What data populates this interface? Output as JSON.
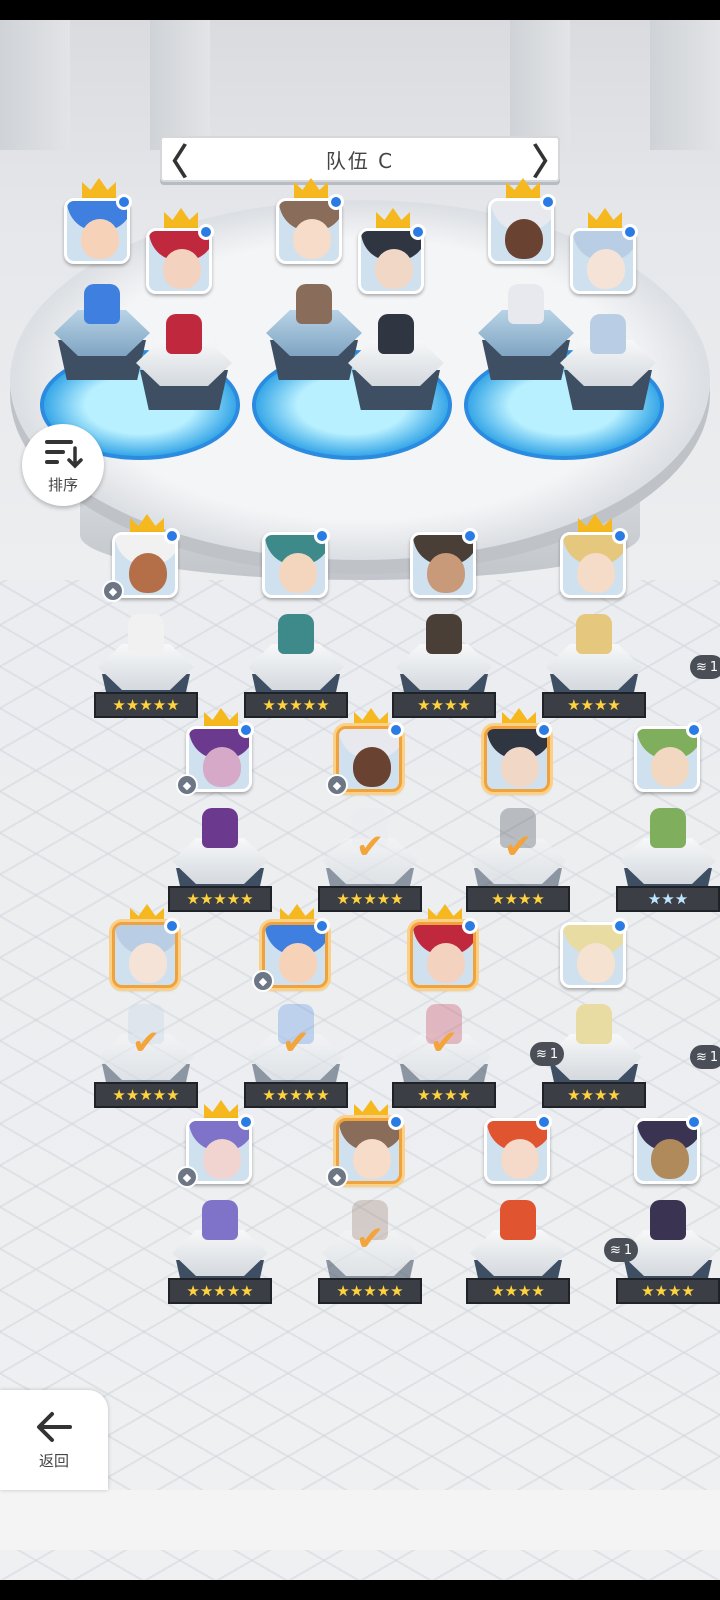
{
  "header": {
    "team_title": "队伍 C",
    "prev_label": "〈",
    "next_label": "〉"
  },
  "sort": {
    "label": "排序",
    "icon": "sort-icon"
  },
  "back": {
    "label": "返回",
    "icon": "arrow-left-icon"
  },
  "team_slots": [
    {
      "hair": "#3f7fe0",
      "skin": "#f6d3b8",
      "selected": true
    },
    {
      "hair": "#c0283d",
      "skin": "#f4d2c0",
      "selected": true
    },
    {
      "hair": "#8a6c5a",
      "skin": "#f6dcc9",
      "selected": true
    },
    {
      "hair": "#2f3642",
      "skin": "#f0d7c6",
      "selected": true
    },
    {
      "hair": "#e8e9ee",
      "skin": "#6a4232",
      "selected": true
    },
    {
      "hair": "#b9cde4",
      "skin": "#f5e3d8",
      "selected": true
    }
  ],
  "roster": [
    {
      "stars": "★★★★★",
      "star_color": "gold",
      "crown": true,
      "gem": true,
      "selected": false,
      "hair": "#f1f1f1",
      "skin": "#b56f48"
    },
    {
      "stars": "★★★★★",
      "star_color": "gold",
      "crown": false,
      "gem": false,
      "selected": false,
      "hair": "#3e8a8a",
      "skin": "#f4d6bf"
    },
    {
      "stars": "★★★★",
      "star_color": "gold",
      "crown": false,
      "gem": false,
      "selected": false,
      "hair": "#4a3f37",
      "skin": "#c99a7a"
    },
    {
      "stars": "★★★★",
      "star_color": "gold",
      "crown": true,
      "gem": false,
      "selected": false,
      "hair": "#e5c77d",
      "skin": "#f4dcc8"
    },
    {
      "stars": "★★★★★",
      "star_color": "gold",
      "crown": true,
      "gem": true,
      "selected": false,
      "hair": "#6b3a8f",
      "skin": "#d6a9c9"
    },
    {
      "stars": "★★★★★",
      "star_color": "gold",
      "crown": true,
      "gem": true,
      "selected": true,
      "hair": "#e8e9ee",
      "skin": "#6a4232"
    },
    {
      "stars": "★★★★",
      "star_color": "gold",
      "crown": true,
      "gem": false,
      "selected": true,
      "hair": "#2f3642",
      "skin": "#f0d7c6"
    },
    {
      "stars": "★★★",
      "star_color": "blue",
      "crown": false,
      "gem": false,
      "selected": false,
      "hair": "#7fae5c",
      "skin": "#f2d8c0"
    },
    {
      "stars": "★★★★★",
      "star_color": "gold",
      "crown": true,
      "gem": false,
      "selected": true,
      "hair": "#b9cde4",
      "skin": "#f5e3d8"
    },
    {
      "stars": "★★★★★",
      "star_color": "gold",
      "crown": true,
      "gem": true,
      "selected": true,
      "hair": "#3f7fe0",
      "skin": "#f6d3b8"
    },
    {
      "stars": "★★★★",
      "star_color": "gold",
      "crown": true,
      "gem": false,
      "selected": true,
      "hair": "#c0283d",
      "skin": "#f4d2c0"
    },
    {
      "stars": "★★★★",
      "star_color": "gold",
      "crown": false,
      "gem": false,
      "selected": false,
      "hair": "#e9dca3",
      "skin": "#f6e2d1",
      "dup": "1"
    },
    {
      "stars": "★★★★★",
      "star_color": "gold",
      "crown": true,
      "gem": true,
      "selected": false,
      "hair": "#7e73c8",
      "skin": "#f1d3d0"
    },
    {
      "stars": "★★★★★",
      "star_color": "gold",
      "crown": true,
      "gem": true,
      "selected": true,
      "hair": "#8a6c5a",
      "skin": "#f6dcc9"
    },
    {
      "stars": "★★★★",
      "star_color": "gold",
      "crown": false,
      "gem": false,
      "selected": false,
      "hair": "#e0542f",
      "skin": "#f5d9c9"
    },
    {
      "stars": "★★★★",
      "star_color": "gold",
      "crown": false,
      "gem": false,
      "selected": false,
      "hair": "#3b3352",
      "skin": "#b08a5a",
      "dup": "1"
    }
  ],
  "edge_dup_label": "1"
}
